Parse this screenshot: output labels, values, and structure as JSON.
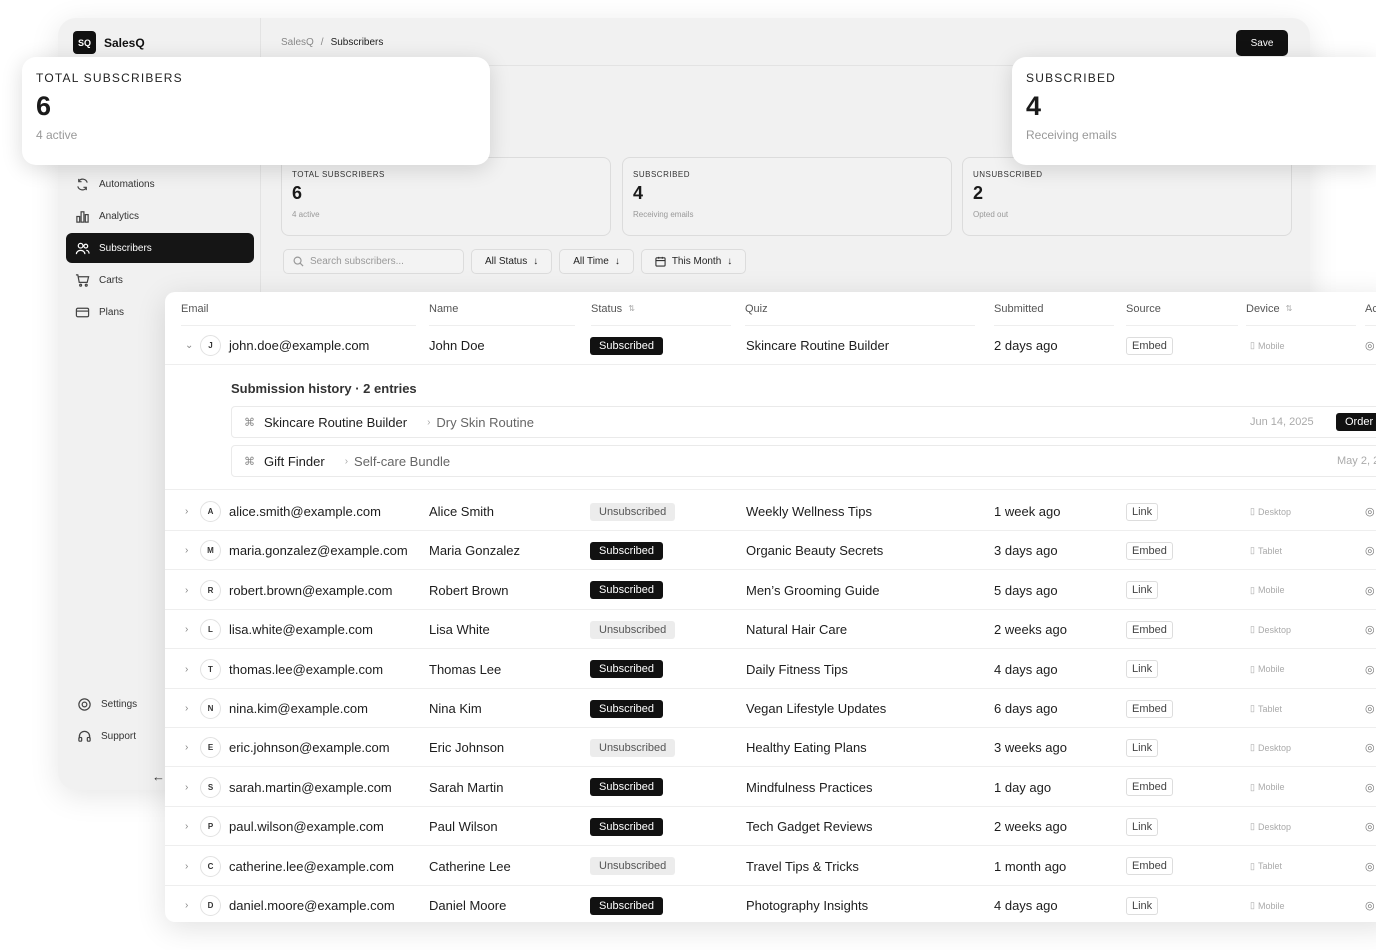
{
  "app": {
    "logo_mark": "SQ",
    "logo_text": "SalesQ",
    "breadcrumb": [
      "SalesQ",
      "/",
      "Subscribers"
    ],
    "save_label": "Save"
  },
  "sidebar": {
    "items": [
      {
        "label": "Automations",
        "icon": "refresh-icon",
        "active": false
      },
      {
        "label": "Analytics",
        "icon": "bar-chart-icon",
        "active": false
      },
      {
        "label": "Subscribers",
        "icon": "users-icon",
        "active": true
      },
      {
        "label": "Carts",
        "icon": "cart-icon",
        "active": false
      },
      {
        "label": "Plans",
        "icon": "credit-card-icon",
        "active": false
      }
    ],
    "footer": [
      {
        "label": "Settings",
        "icon": "gear-icon"
      },
      {
        "label": "Support",
        "icon": "headset-icon"
      }
    ],
    "collapse_glyph": "←"
  },
  "stats": [
    {
      "label": "Total Subscribers",
      "value": "6",
      "sub": "4 active"
    },
    {
      "label": "Subscribed",
      "value": "4",
      "sub": "Receiving emails"
    },
    {
      "label": "Unsubscribed",
      "value": "2",
      "sub": "Opted out"
    }
  ],
  "filters": {
    "search_placeholder": "Search subscribers...",
    "status": "All Status",
    "time": "All Time",
    "range": "This Month"
  },
  "table": {
    "headers": [
      "Email",
      "Name",
      "Status",
      "Quiz",
      "Submitted",
      "Source",
      "Device",
      "Ac"
    ],
    "expanded": {
      "title": "Submission history · 2 entries",
      "entries": [
        {
          "quiz": "Skincare Routine Builder",
          "result": "Dry Skin Routine",
          "date": "Jun 14, 2025",
          "tag": "Order"
        },
        {
          "quiz": "Gift Finder",
          "result": "Self-care Bundle",
          "date": "May 2, 2",
          "tag": ""
        }
      ]
    },
    "rows": [
      {
        "initial": "J",
        "email": "john.doe@example.com",
        "name": "John Doe",
        "status": "Subscribed",
        "quiz": "Skincare Routine Builder",
        "submitted": "2 days ago",
        "source": "Embed",
        "device": "Mobile",
        "chevron": "⌄"
      },
      {
        "initial": "A",
        "email": "alice.smith@example.com",
        "name": "Alice Smith",
        "status": "Unsubscribed",
        "quiz": "Weekly Wellness Tips",
        "submitted": "1 week ago",
        "source": "Link",
        "device": "Desktop",
        "chevron": "›"
      },
      {
        "initial": "M",
        "email": "maria.gonzalez@example.com",
        "name": "Maria Gonzalez",
        "status": "Subscribed",
        "quiz": "Organic Beauty Secrets",
        "submitted": "3 days ago",
        "source": "Embed",
        "device": "Tablet",
        "chevron": "›"
      },
      {
        "initial": "R",
        "email": "robert.brown@example.com",
        "name": "Robert Brown",
        "status": "Subscribed",
        "quiz": "Men’s Grooming Guide",
        "submitted": "5 days ago",
        "source": "Link",
        "device": "Mobile",
        "chevron": "›"
      },
      {
        "initial": "L",
        "email": "lisa.white@example.com",
        "name": "Lisa White",
        "status": "Unsubscribed",
        "quiz": "Natural Hair Care",
        "submitted": "2 weeks ago",
        "source": "Embed",
        "device": "Desktop",
        "chevron": "›"
      },
      {
        "initial": "T",
        "email": "thomas.lee@example.com",
        "name": "Thomas Lee",
        "status": "Subscribed",
        "quiz": "Daily Fitness Tips",
        "submitted": "4 days ago",
        "source": "Link",
        "device": "Mobile",
        "chevron": "›"
      },
      {
        "initial": "N",
        "email": "nina.kim@example.com",
        "name": "Nina Kim",
        "status": "Subscribed",
        "quiz": "Vegan Lifestyle Updates",
        "submitted": "6 days ago",
        "source": "Embed",
        "device": "Tablet",
        "chevron": "›"
      },
      {
        "initial": "E",
        "email": "eric.johnson@example.com",
        "name": "Eric Johnson",
        "status": "Unsubscribed",
        "quiz": "Healthy Eating Plans",
        "submitted": "3 weeks ago",
        "source": "Link",
        "device": "Desktop",
        "chevron": "›"
      },
      {
        "initial": "S",
        "email": "sarah.martin@example.com",
        "name": "Sarah Martin",
        "status": "Subscribed",
        "quiz": "Mindfulness Practices",
        "submitted": "1 day ago",
        "source": "Embed",
        "device": "Mobile",
        "chevron": "›"
      },
      {
        "initial": "P",
        "email": "paul.wilson@example.com",
        "name": "Paul Wilson",
        "status": "Subscribed",
        "quiz": "Tech Gadget Reviews",
        "submitted": "2 weeks ago",
        "source": "Link",
        "device": "Desktop",
        "chevron": "›"
      },
      {
        "initial": "C",
        "email": "catherine.lee@example.com",
        "name": "Catherine Lee",
        "status": "Unsubscribed",
        "quiz": "Travel Tips & Tricks",
        "submitted": "1 month ago",
        "source": "Embed",
        "device": "Tablet",
        "chevron": "›"
      },
      {
        "initial": "D",
        "email": "daniel.moore@example.com",
        "name": "Daniel Moore",
        "status": "Subscribed",
        "quiz": "Photography Insights",
        "submitted": "4 days ago",
        "source": "Link",
        "device": "Mobile",
        "chevron": "›"
      }
    ]
  },
  "colors": {
    "accent": "#111111",
    "muted": "#999999",
    "badge_unsubscribed": "#ececec"
  }
}
